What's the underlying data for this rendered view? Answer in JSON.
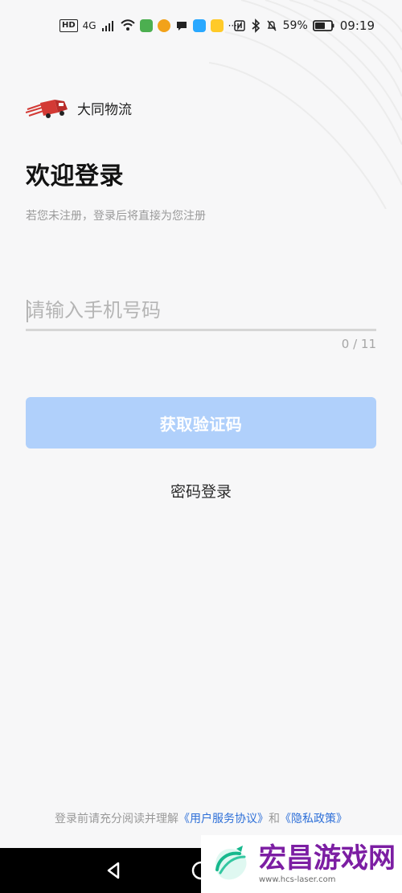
{
  "status_bar": {
    "hd": "HD",
    "network": "4G",
    "battery": "59%",
    "time": "09:19",
    "more": "···"
  },
  "brand": {
    "name": "大同物流"
  },
  "login": {
    "title": "欢迎登录",
    "subtitle": "若您未注册，登录后将直接为您注册",
    "phone_placeholder": "请输入手机号码",
    "phone_value": "",
    "counter": "0 / 11",
    "get_code": "获取验证码",
    "password_login": "密码登录"
  },
  "agreement": {
    "prefix": "登录前请充分阅读并理解",
    "service_link": "《用户服务协议》",
    "and": "和",
    "privacy_link": "《隐私政策》"
  },
  "watermark": {
    "title": "宏昌游戏网",
    "url": "www.hcs-laser.com"
  },
  "colors": {
    "background": "#f7f7f8",
    "button_disabled": "#b0d0fb",
    "link": "#2d6fd8",
    "brand_red": "#d33a35",
    "watermark_purple": "#7c1ea3"
  },
  "icons": {
    "logo": "truck-logo-icon",
    "back": "back-triangle-icon",
    "home": "home-circle-icon"
  }
}
